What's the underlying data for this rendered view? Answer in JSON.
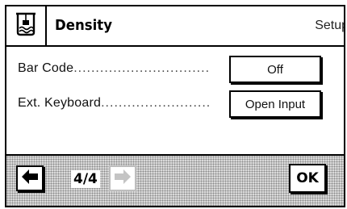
{
  "header": {
    "app_icon": "density-beaker-icon",
    "title": "Density",
    "right_label": "Setup"
  },
  "settings": [
    {
      "label": "Bar Code",
      "dots": "...............................",
      "value": "Off"
    },
    {
      "label": "Ext. Keyboard",
      "dots": ".........................",
      "value": "Open Input"
    }
  ],
  "footer": {
    "back_icon": "arrow-left-icon",
    "page_indicator": "4/4",
    "forward_icon": "arrow-right-icon",
    "forward_enabled": false,
    "ok_label": "OK"
  }
}
